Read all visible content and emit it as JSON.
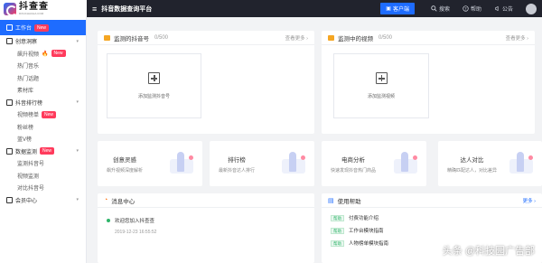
{
  "app": {
    "logo_text": "抖查查",
    "logo_sub": "DOUCHACHA.COM",
    "platform_title": "抖音数据查询平台",
    "client_button": "客户端",
    "search": "搜索",
    "help": "帮助",
    "notice": "公告"
  },
  "sidebar": {
    "workbench": "工作台",
    "workbench_badge": "New",
    "items": [
      {
        "label": "创意洞察",
        "type": "group"
      },
      {
        "label": "飙升视频",
        "type": "child",
        "badge": "New",
        "fire": true
      },
      {
        "label": "热门音乐",
        "type": "child"
      },
      {
        "label": "热门话题",
        "type": "child"
      },
      {
        "label": "素材库",
        "type": "child"
      },
      {
        "label": "抖音排行榜",
        "type": "group"
      },
      {
        "label": "视频榜单",
        "type": "child",
        "badge": "New"
      },
      {
        "label": "粉丝榜",
        "type": "child"
      },
      {
        "label": "蓝V榜",
        "type": "child"
      },
      {
        "label": "数据监测",
        "type": "group",
        "badge": "New"
      },
      {
        "label": "监测抖音号",
        "type": "child"
      },
      {
        "label": "视频监测",
        "type": "child"
      },
      {
        "label": "对比抖音号",
        "type": "child"
      },
      {
        "label": "会员中心",
        "type": "group"
      }
    ]
  },
  "monitor_accounts": {
    "title": "监测的抖音号",
    "count": "0/500",
    "more": "查看更多",
    "add_label": "添加监测抖音号"
  },
  "monitor_videos": {
    "title": "监测中的视频",
    "count": "0/500",
    "more": "查看更多",
    "add_label": "添加监测视频"
  },
  "features": [
    {
      "title": "创意灵感",
      "sub": "飙升视频深度解析"
    },
    {
      "title": "排行榜",
      "sub": "最新抖音达人排行"
    },
    {
      "title": "电商分析",
      "sub": "快速发现抖音热门商品"
    },
    {
      "title": "达人对比",
      "sub": "精确匹配达人，对比差异"
    }
  ],
  "messages": {
    "title": "消息中心",
    "items": [
      {
        "text": "欢迎您加入抖查查",
        "time": "2019-12-23 16:55:52"
      }
    ]
  },
  "help": {
    "title": "使用帮助",
    "more": "更多",
    "tag": "帮助",
    "items": [
      "付费功能介绍",
      "工作台模块指南",
      "人物榜单模块指南"
    ]
  },
  "watermark": "头条 @科技园广告部",
  "colors": {
    "accent": "#1e6cff",
    "topbar": "#21232d",
    "badge": "#ff3b5c"
  }
}
